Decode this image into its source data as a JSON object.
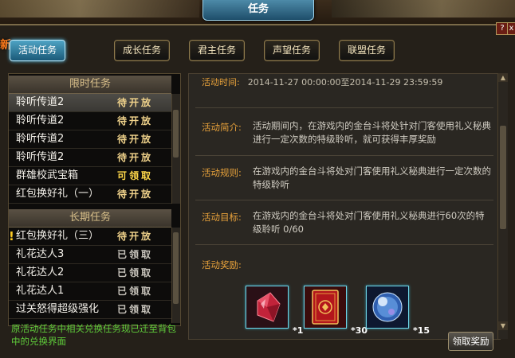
{
  "window": {
    "title": "任务",
    "help_label": "?",
    "close_label": "x"
  },
  "new_badge": "新",
  "category_tabs": [
    {
      "label": "活动任务",
      "active": true
    },
    {
      "label": "成长任务",
      "active": false
    },
    {
      "label": "君主任务",
      "active": false
    },
    {
      "label": "声望任务",
      "active": false
    },
    {
      "label": "联盟任务",
      "active": false
    }
  ],
  "limited_section": {
    "title": "限时任务",
    "items": [
      {
        "name": "聆听传道2",
        "status": "待开放",
        "status_type": "pending",
        "selected": true
      },
      {
        "name": "聆听传道2",
        "status": "待开放",
        "status_type": "pending"
      },
      {
        "name": "聆听传道2",
        "status": "待开放",
        "status_type": "pending"
      },
      {
        "name": "聆听传道2",
        "status": "待开放",
        "status_type": "pending"
      },
      {
        "name": "群雄校武宝箱",
        "status": "可领取",
        "status_type": "claimable"
      },
      {
        "name": "红包换好礼（一）",
        "status": "待开放",
        "status_type": "pending"
      }
    ]
  },
  "long_section": {
    "title": "长期任务",
    "items": [
      {
        "name": "红包换好礼（三）",
        "status": "待开放",
        "status_type": "pending",
        "warn": "!"
      },
      {
        "name": "礼花达人3",
        "status": "已领取",
        "status_type": "done"
      },
      {
        "name": "礼花达人2",
        "status": "已领取",
        "status_type": "done"
      },
      {
        "name": "礼花达人1",
        "status": "已领取",
        "status_type": "done"
      },
      {
        "name": "过关怒得超级强化",
        "status": "已领取",
        "status_type": "done"
      }
    ]
  },
  "notice": "原活动任务中相关兑换任务现已迁至背包中的兑换界面",
  "detail": {
    "time_label": "活动时间:",
    "time_value": "2014-11-27  00:00:00至2014-11-29  23:59:59",
    "intro_label": "活动简介:",
    "intro_text": "活动期间内，在游戏内的金台斗将处针对门客使用礼义秘典进行一定次数的特级聆听，就可获得丰厚奖励",
    "rule_label": "活动规则:",
    "rule_text": "在游戏内的金台斗将处对门客使用礼义秘典进行一定次数的特级聆听",
    "goal_label": "活动目标:",
    "goal_text": "在游戏内的金台斗将处对门客使用礼义秘典进行60次的特级聆听 0/60",
    "reward_label": "活动奖励:",
    "rewards": [
      {
        "icon": "red-gem-icon",
        "count": "*1"
      },
      {
        "icon": "ritual-book-icon",
        "count": "*30"
      },
      {
        "icon": "crystal-orb-icon",
        "count": "*15"
      }
    ],
    "claim_button": "领取奖励"
  },
  "colors": {
    "accent_blue": "#4ea3c4",
    "label_orange": "#e8a23b",
    "notice_green": "#5fcc3a"
  }
}
